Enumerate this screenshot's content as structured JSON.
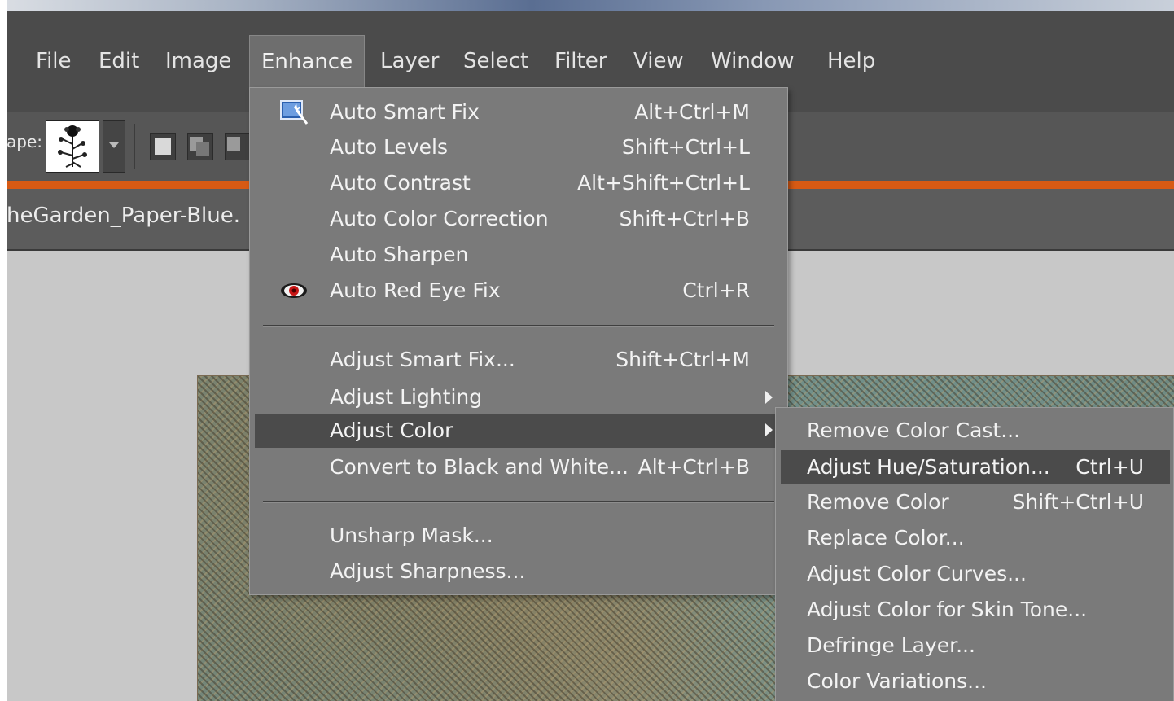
{
  "menubar": {
    "items": [
      {
        "label": "File"
      },
      {
        "label": "Edit"
      },
      {
        "label": "Image"
      },
      {
        "label": "Enhance"
      },
      {
        "label": "Layer"
      },
      {
        "label": "Select"
      },
      {
        "label": "Filter"
      },
      {
        "label": "View"
      },
      {
        "label": "Window"
      },
      {
        "label": "Help"
      }
    ],
    "active": "Enhance"
  },
  "options_bar": {
    "shape_label": "ape:",
    "shape_icon": "flower-shape-icon",
    "mode_icons": [
      "new-shape-layer-icon",
      "add-to-shape-icon",
      "subtract-shape-icon"
    ]
  },
  "document": {
    "tab_label": "heGarden_Paper-Blue."
  },
  "enhance_menu": {
    "items": [
      {
        "label": "Auto Smart Fix",
        "shortcut": "Alt+Ctrl+M",
        "icon": "auto-smart-fix-icon"
      },
      {
        "label": "Auto Levels",
        "shortcut": "Shift+Ctrl+L"
      },
      {
        "label": "Auto Contrast",
        "shortcut": "Alt+Shift+Ctrl+L"
      },
      {
        "label": "Auto Color Correction",
        "shortcut": "Shift+Ctrl+B"
      },
      {
        "label": "Auto Sharpen",
        "shortcut": ""
      },
      {
        "label": "Auto Red Eye Fix",
        "shortcut": "Ctrl+R",
        "icon": "red-eye-icon"
      },
      {
        "label": "Adjust Smart Fix...",
        "shortcut": "Shift+Ctrl+M"
      },
      {
        "label": "Adjust Lighting",
        "shortcut": "",
        "submenu": true
      },
      {
        "label": "Adjust Color",
        "shortcut": "",
        "submenu": true,
        "highlighted": true
      },
      {
        "label": "Convert to Black and White...",
        "shortcut": "Alt+Ctrl+B"
      },
      {
        "label": "Unsharp Mask...",
        "shortcut": ""
      },
      {
        "label": "Adjust Sharpness...",
        "shortcut": ""
      }
    ]
  },
  "adjust_color_submenu": {
    "items": [
      {
        "label": "Remove Color Cast...",
        "shortcut": ""
      },
      {
        "label": "Adjust Hue/Saturation...",
        "shortcut": "Ctrl+U",
        "highlighted": true
      },
      {
        "label": "Remove Color",
        "shortcut": "Shift+Ctrl+U"
      },
      {
        "label": "Replace Color...",
        "shortcut": ""
      },
      {
        "label": "Adjust Color Curves...",
        "shortcut": ""
      },
      {
        "label": "Adjust Color for Skin Tone...",
        "shortcut": ""
      },
      {
        "label": "Defringe Layer...",
        "shortcut": ""
      },
      {
        "label": "Color Variations...",
        "shortcut": ""
      }
    ]
  },
  "colors": {
    "menubar_bg": "#4b4b4b",
    "menu_bg": "#7a7a7a",
    "highlight_bg": "#4b4b4b",
    "accent_orange": "#d75a14"
  }
}
